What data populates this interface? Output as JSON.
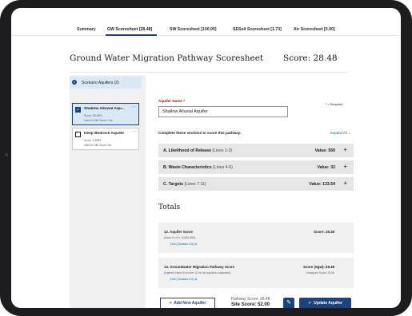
{
  "tabs": [
    "Summary",
    "GW Scoresheet [28.48]",
    "SW Scoresheet [100.00]",
    "SESoil Scoresheet [1.73]",
    "Air Scoresheet [0.00]"
  ],
  "page": {
    "title": "Ground Water Migration Pathway Scoresheet",
    "score": "Score: 28.48",
    "more": "···"
  },
  "sidebar": {
    "number": "1",
    "scenario": "Scenario Aquifers (2)",
    "aquifers": [
      {
        "name": "Shallow Alluvial Aqu...",
        "line1": "Score: 28.4800",
        "line2": "Used in Site Score: Yes",
        "checked": "✓"
      },
      {
        "name": "Deep Bedrock Aquifer",
        "line1": "Score: 2.8283",
        "line2": "Used in Site Score: No",
        "checked": ""
      }
    ]
  },
  "form": {
    "aquifer_label": "Aquifer Name",
    "required_star": "*",
    "required_note": "= Required",
    "aquifer_value": "Shallow Alluvial Aquifer",
    "complete_text": "Complete these sections to score this pathway.",
    "expand_all": "Expand All"
  },
  "sections": [
    {
      "label": "A. Likelihood of Release",
      "lines": "(Lines 1-2)",
      "value": "Value: 550"
    },
    {
      "label": "B. Waste Characteristics",
      "lines": "(Lines 4-6)",
      "value": "Value: 32"
    },
    {
      "label": "C. Targets",
      "lines": "(Lines 7-11)",
      "value": "Value: 133.54"
    }
  ],
  "totals": {
    "heading": "Totals",
    "aquifer_score": {
      "title": "12. Aquifer Score",
      "sub": "(lines 3 x 6 x 11)/82,500)",
      "link": "DOC (Section 3.0)",
      "score": "Score: 28.48"
    },
    "gw_score": {
      "title": "13. Groundwater Migration Pathway Score",
      "sub": "(highest value from line 12 for all aquifers evaluated)",
      "link": "DOC (Section 3.0)",
      "score": "Score (Sgw): 28.48",
      "uncapped": "Uncapped Score: 28.48"
    }
  },
  "footer": {
    "add_button": "Add New Aquifer",
    "pathway_score": "Pathway Score: 28.48",
    "site_score": "Site Score: 52.00",
    "update_button": "Update Aquifer"
  },
  "colors": {
    "primary": "#1a4480",
    "selected_bg": "#d9e8f6",
    "link": "#005ea2"
  }
}
